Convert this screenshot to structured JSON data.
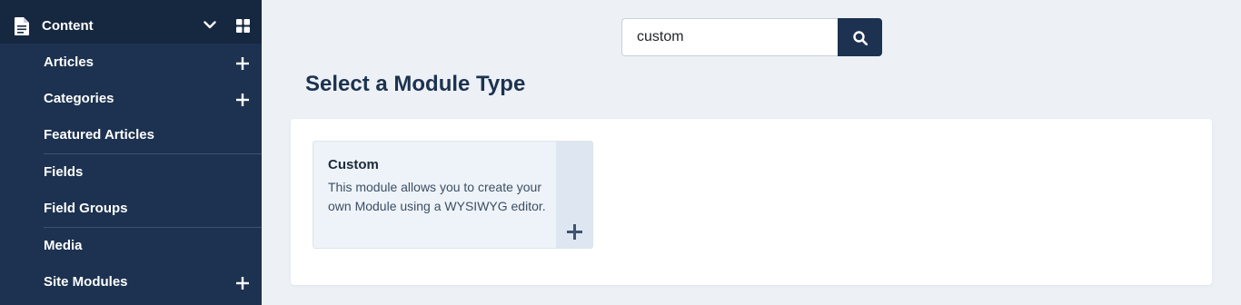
{
  "sidebar": {
    "header": {
      "label": "Content",
      "icon": "document-icon"
    },
    "items": [
      {
        "label": "Articles",
        "has_add": true
      },
      {
        "label": "Categories",
        "has_add": true
      },
      {
        "label": "Featured Articles",
        "has_add": false
      },
      {
        "label": "Fields",
        "has_add": false
      },
      {
        "label": "Field Groups",
        "has_add": false
      },
      {
        "label": "Media",
        "has_add": false
      },
      {
        "label": "Site Modules",
        "has_add": true
      }
    ]
  },
  "search": {
    "value": "custom"
  },
  "main": {
    "title": "Select a Module Type",
    "cards": [
      {
        "title": "Custom",
        "description": "This module allows you to create your own Module using a WYSIWYG editor."
      }
    ]
  },
  "colors": {
    "sidebar_bg": "#1c3250",
    "sidebar_header_bg": "#162840",
    "page_bg": "#edf1f6",
    "accent": "#1c3250"
  }
}
